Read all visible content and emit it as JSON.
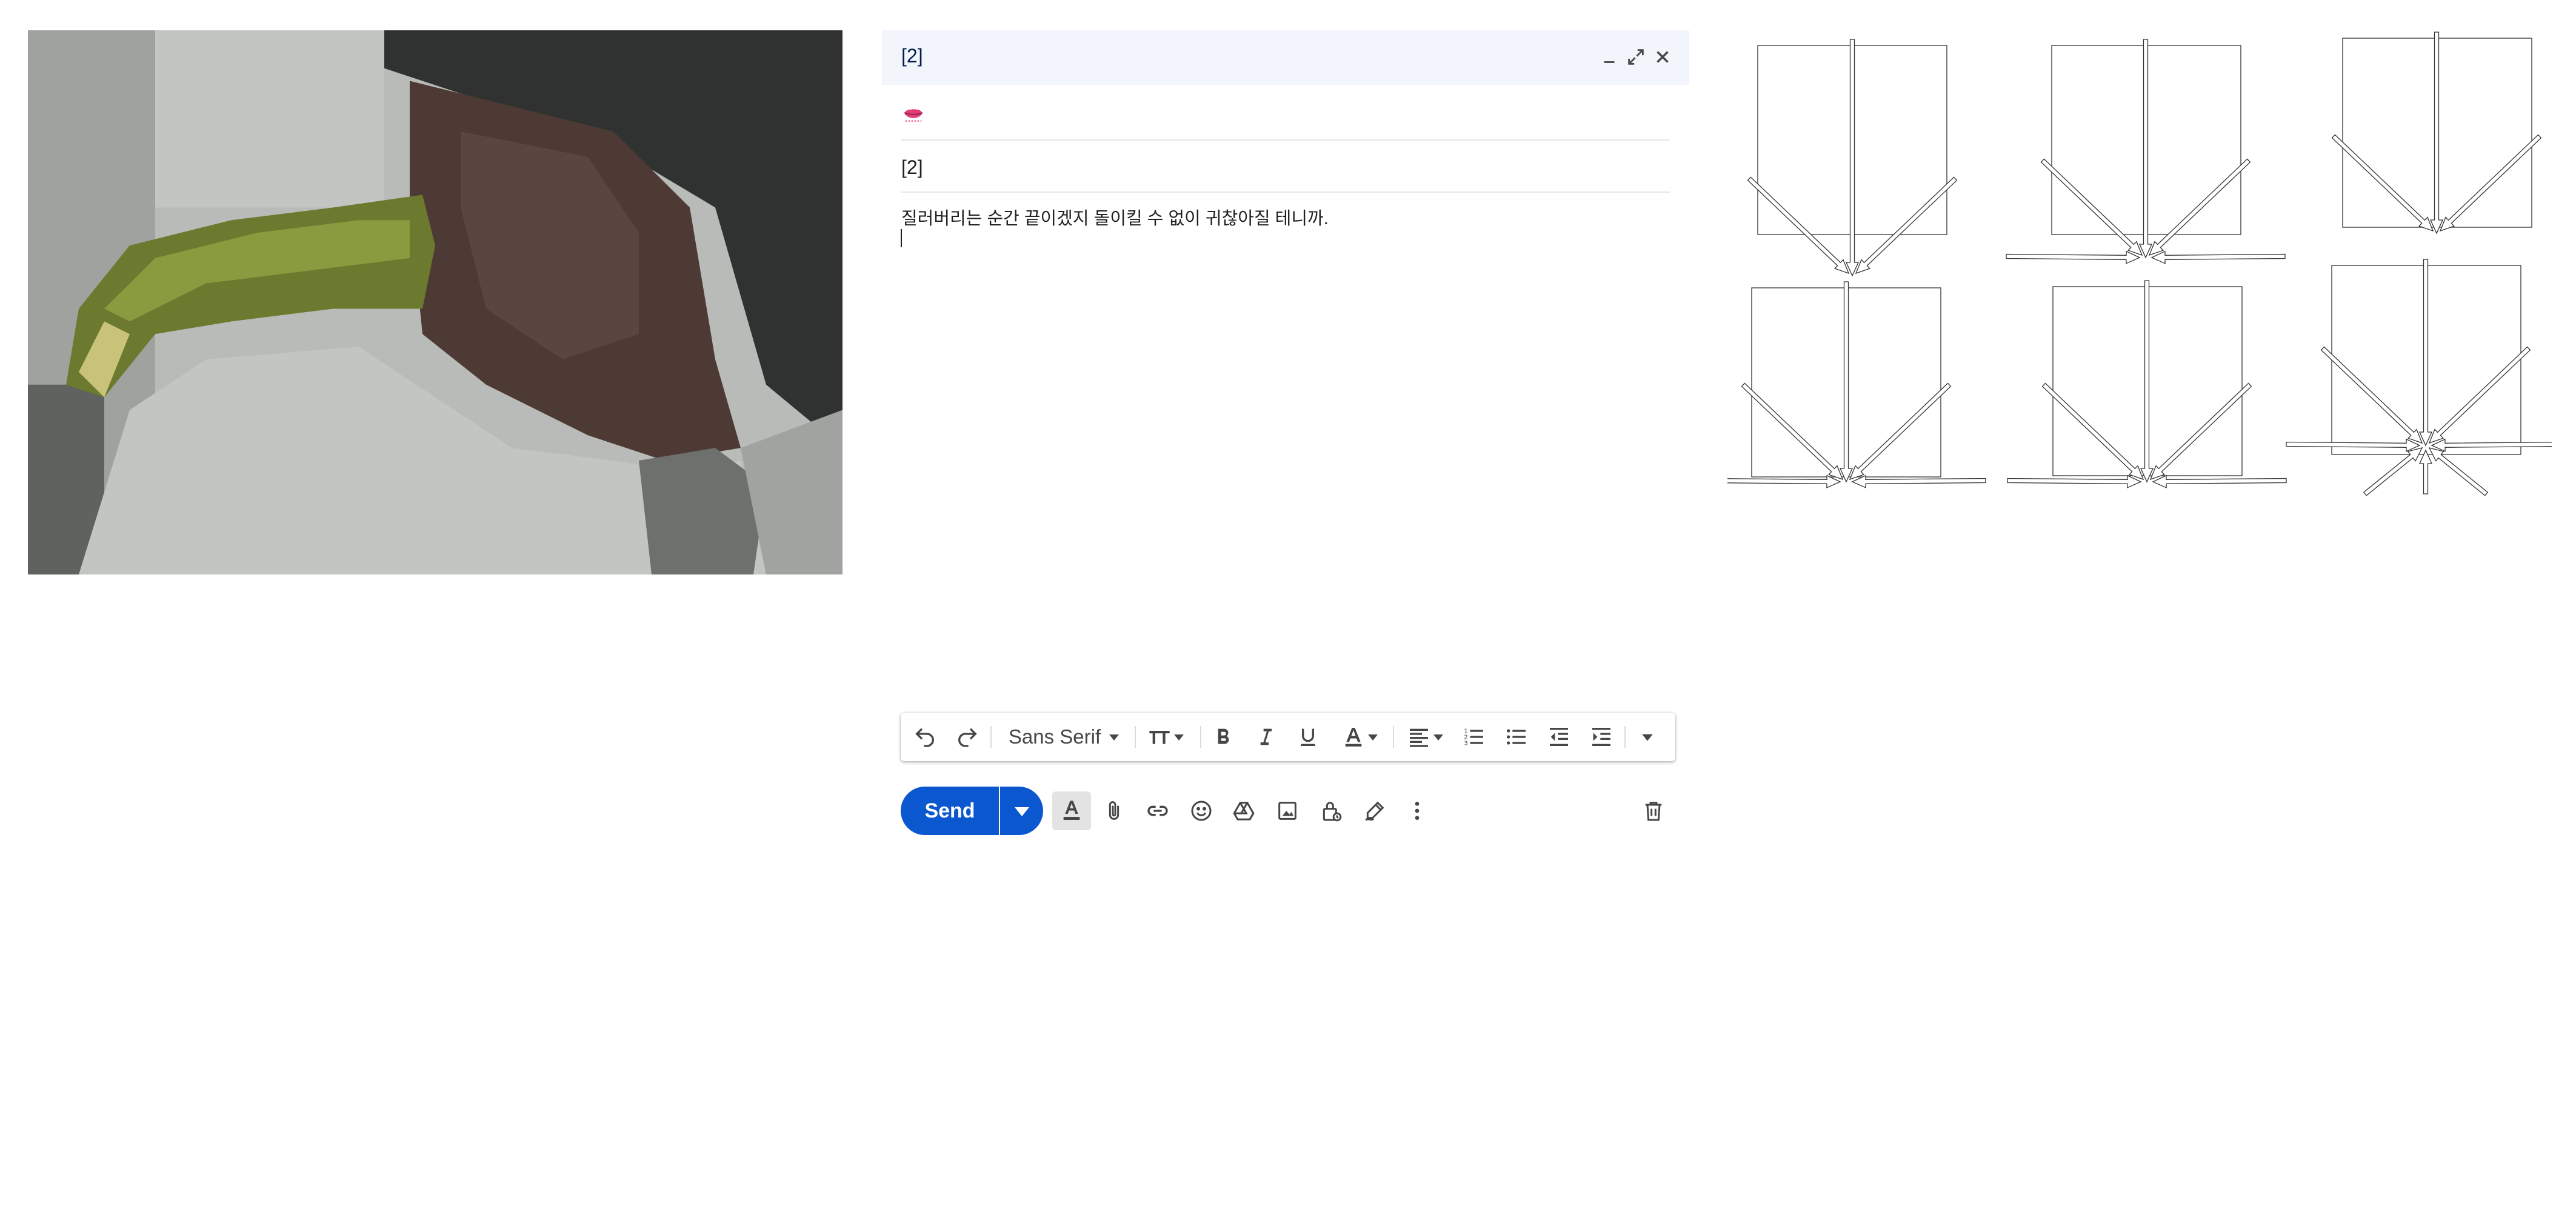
{
  "photo": {
    "icon": "pixelated-photo-image",
    "palette": {
      "background": "#b8bbb8",
      "green": "#6b7a2e",
      "skin": "#4e3a35",
      "dark": "#2a2c2b"
    }
  },
  "compose": {
    "title": "[2]",
    "header_buttons": [
      "minimize-icon",
      "expand-icon",
      "close-icon"
    ],
    "recipient_icon": "lips-emoji-icon",
    "subject": "[2]",
    "body": "질러버리는 순간 끝이겠지 돌이킬 수 없이 귀찮아질 테니까."
  },
  "format_bar": {
    "font": "Sans Serif",
    "buttons": [
      "undo-icon",
      "redo-icon",
      "font-family-select",
      "text-size-icon",
      "bold-icon",
      "italic-icon",
      "underline-icon",
      "text-color-icon",
      "align-icon",
      "numbered-list-icon",
      "bulleted-list-icon",
      "indent-less-icon",
      "indent-more-icon",
      "more-formatting-icon"
    ]
  },
  "actions": {
    "send_label": "Send",
    "icons": [
      "formatting-options-icon",
      "attach-file-icon",
      "insert-link-icon",
      "insert-emoji-icon",
      "google-drive-icon",
      "insert-photo-icon",
      "confidential-mode-icon",
      "insert-signature-icon",
      "more-options-icon",
      "discard-draft-icon"
    ]
  },
  "diagrams": {
    "icon": "converging-arrows-diagram",
    "panel_count": 6
  }
}
